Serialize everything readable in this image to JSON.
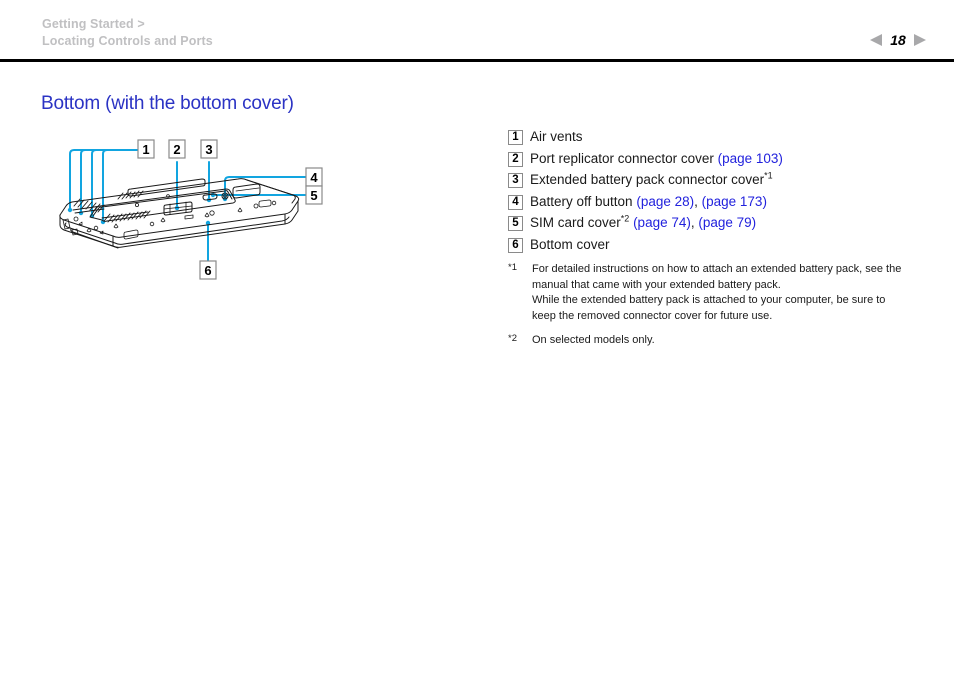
{
  "header": {
    "breadcrumb_line1": "Getting Started >",
    "breadcrumb_line2": "Locating Controls and Ports",
    "page_number": "18",
    "prev_icon": "triangle-left-icon",
    "next_icon": "triangle-right-icon"
  },
  "title": "Bottom (with the bottom cover)",
  "figure": {
    "alt": "Bottom view line drawing of a VAIO notebook computer with the bottom cover, showing numbered callouts 1 through 6",
    "callouts": [
      "1",
      "2",
      "3",
      "4",
      "5",
      "6"
    ],
    "line_color": "#12a5e0",
    "outline_color": "#1a1a1a"
  },
  "legend": [
    {
      "num": "1",
      "parts": [
        {
          "t": "Air vents",
          "kind": "text"
        }
      ]
    },
    {
      "num": "2",
      "parts": [
        {
          "t": "Port replicator connector cover ",
          "kind": "text"
        },
        {
          "t": "(page 103)",
          "kind": "link"
        }
      ]
    },
    {
      "num": "3",
      "parts": [
        {
          "t": "Extended battery pack connector cover",
          "kind": "text"
        },
        {
          "t": "*1",
          "kind": "sup"
        }
      ]
    },
    {
      "num": "4",
      "parts": [
        {
          "t": "Battery off button ",
          "kind": "text"
        },
        {
          "t": "(page 28)",
          "kind": "link"
        },
        {
          "t": ", ",
          "kind": "text"
        },
        {
          "t": "(page 173)",
          "kind": "link"
        }
      ]
    },
    {
      "num": "5",
      "parts": [
        {
          "t": "SIM card cover",
          "kind": "text"
        },
        {
          "t": "*2",
          "kind": "sup"
        },
        {
          "t": " ",
          "kind": "text"
        },
        {
          "t": "(page 74)",
          "kind": "link"
        },
        {
          "t": ", ",
          "kind": "text"
        },
        {
          "t": "(page 79)",
          "kind": "link"
        }
      ]
    },
    {
      "num": "6",
      "parts": [
        {
          "t": "Bottom cover",
          "kind": "text"
        }
      ]
    }
  ],
  "footnotes": [
    {
      "mark": "*1",
      "lines": [
        "For detailed instructions on how to attach an extended battery pack, see the",
        "manual that came with your extended battery pack.",
        "While the extended battery pack is attached to your computer, be sure to",
        "keep the removed connector cover for future use."
      ]
    },
    {
      "mark": "*2",
      "lines": [
        "On selected models only."
      ]
    }
  ]
}
